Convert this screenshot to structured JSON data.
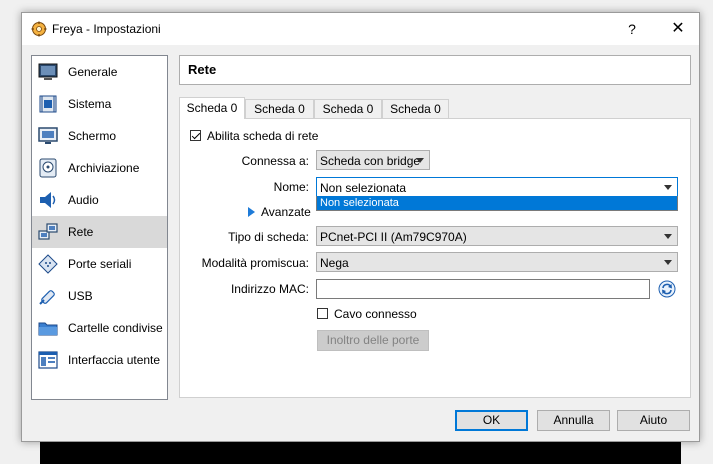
{
  "window": {
    "title": "Freya - Impostazioni",
    "help_label": "?",
    "close_label": "✕"
  },
  "sidebar": {
    "items": [
      {
        "label": "Generale",
        "icon": "monitor-general-icon"
      },
      {
        "label": "Sistema",
        "icon": "chip-icon"
      },
      {
        "label": "Schermo",
        "icon": "display-icon"
      },
      {
        "label": "Archiviazione",
        "icon": "storage-disk-icon"
      },
      {
        "label": "Audio",
        "icon": "speaker-icon"
      },
      {
        "label": "Rete",
        "icon": "network-icon",
        "selected": true
      },
      {
        "label": "Porte seriali",
        "icon": "serial-port-icon"
      },
      {
        "label": "USB",
        "icon": "usb-icon"
      },
      {
        "label": "Cartelle condivise",
        "icon": "folder-icon"
      },
      {
        "label": "Interfaccia utente",
        "icon": "user-interface-icon"
      }
    ]
  },
  "header": {
    "title": "Rete"
  },
  "tabs": [
    {
      "label": "Scheda 0",
      "active": true
    },
    {
      "label": "Scheda 0"
    },
    {
      "label": "Scheda 0"
    },
    {
      "label": "Scheda 0"
    }
  ],
  "form": {
    "enable_label": "Abilita scheda di rete",
    "enable_checked": true,
    "attached_label": "Connessa a:",
    "attached_value": "Scheda con bridge",
    "name_label": "Nome:",
    "name_value": "Non selezionata",
    "name_dropdown_option": "Non selezionata",
    "advanced_label": "Avanzate",
    "adapter_label": "Tipo di scheda:",
    "adapter_value": "PCnet-PCI II (Am79C970A)",
    "promisc_label": "Modalità promiscua:",
    "promisc_value": "Nega",
    "mac_label": "Indirizzo MAC:",
    "mac_value": "",
    "cable_label": "Cavo connesso",
    "cable_checked": false,
    "port_forward_label": "Inoltro delle porte"
  },
  "buttons": {
    "ok": "OK",
    "cancel": "Annulla",
    "help": "Aiuto"
  },
  "colors": {
    "accent": "#0078d7",
    "selected_item": "#d9d9d9"
  }
}
